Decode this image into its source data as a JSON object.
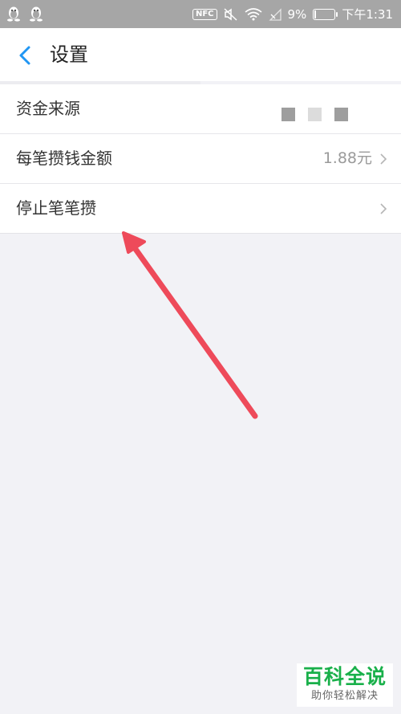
{
  "status_bar": {
    "nfc": "NFC",
    "battery_percent": "9%",
    "battery_level": 0.09,
    "time": "下午1:31",
    "icons": [
      "penguin-app-icon",
      "penguin-app-icon",
      "mute-icon",
      "wifi-icon",
      "no-signal-icon",
      "battery-icon"
    ]
  },
  "header": {
    "title": "设置",
    "back_icon": "chevron-left-icon",
    "accent_color": "#2196F3"
  },
  "settings": {
    "items": [
      {
        "label": "资金来源",
        "value": ""
      },
      {
        "label": "每笔攒钱金额",
        "value": "1.88元"
      },
      {
        "label": "停止笔笔攒",
        "value": ""
      }
    ]
  },
  "annotation": {
    "color": "#EE4A5A"
  },
  "watermark": {
    "title": "百科全说",
    "subtitle": "助你轻松解决"
  }
}
